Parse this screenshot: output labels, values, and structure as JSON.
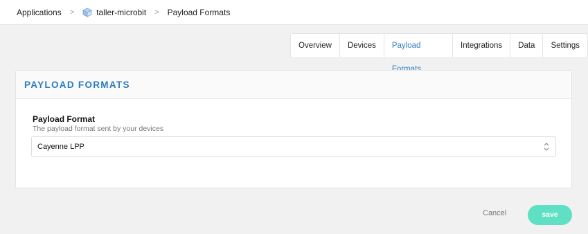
{
  "breadcrumb": {
    "items": [
      {
        "label": "Applications"
      },
      {
        "label": "taller-microbit",
        "icon": "cube-icon"
      },
      {
        "label": "Payload Formats"
      }
    ],
    "separator": ">"
  },
  "tabs": [
    {
      "label": "Overview"
    },
    {
      "label": "Devices"
    },
    {
      "label": "Payload Formats",
      "active": true
    },
    {
      "label": "Integrations"
    },
    {
      "label": "Data"
    },
    {
      "label": "Settings"
    }
  ],
  "card": {
    "title": "PAYLOAD FORMATS",
    "field": {
      "label": "Payload Format",
      "description": "The payload format sent by your devices",
      "selected": "Cayenne LPP"
    }
  },
  "actions": {
    "cancel_label": "Cancel",
    "save_label": "save"
  },
  "colors": {
    "accent": "#2a7bc4",
    "save_button": "#5fe0c5",
    "background": "#f1f1f1"
  }
}
